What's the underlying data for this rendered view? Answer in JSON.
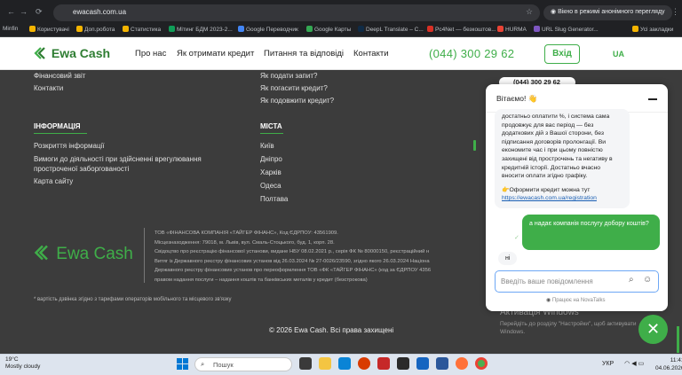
{
  "browser": {
    "url": "ewacash.com.ua",
    "incognito_label": "Вікно в режимі анонімного перегляду",
    "bookmarks": [
      "Minfin",
      "Користувачі",
      "Доп.робота",
      "Статистика",
      "Мітинг БДМ 2023-2...",
      "Google Переводчик",
      "Google Карты",
      "DeepL Translate – C...",
      "Pc4Net — безкоштов...",
      "HURMA",
      "URL Slug Generator...",
      "Усі закладки"
    ]
  },
  "header": {
    "logo": "Ewa Cash",
    "nav": [
      "Про нас",
      "Як отримати кредит",
      "Питання та відповіді",
      "Контакти"
    ],
    "phone": "(044) 300 29 62",
    "login_label": "Вхід",
    "lang": "UA"
  },
  "footer": {
    "col1_links_top": [
      "Фінансовий звіт",
      "Контакти"
    ],
    "col2_links_top": [
      "Як подати запит?",
      "Як погасити кредит?",
      "Як подовжити кредит?"
    ],
    "info_heading": "ІНФОРМАЦІЯ",
    "info_links": [
      "Розкриття інформації",
      "Вимоги до діяльності при здійсненні врегулювання простроченої заборгованості",
      "Карта сайту"
    ],
    "cities_heading": "МІСТА",
    "cities": [
      "Київ",
      "Дніпро",
      "Харків",
      "Одеса",
      "Полтава"
    ],
    "logo": "Ewa Cash",
    "legal": [
      "ТОВ «ФІНАНСОВА КОМПАНІЯ «ТАЙГЕР ФІНАНС», Код ЄДРПОУ: 43561909.",
      "Місцезнаходження: 79018, м. Львів, вул. Смаль-Стоцького, буд. 1, корп. 28.",
      "Свідоцтво про реєстрацію фінансової установи, видане НБУ 08.02.2021 р., серія ФК № 80000150, реєстраційний н",
      "Витяг із Державного реєстру фінансових установ від 26.03.2024 № 27-0026/23590, згідно якого 26.03.2024 Націона",
      "Державного реєстру фінансових установ про переоформлення ТОВ «ФК «ТАЙГЕР ФІНАНС» (код за ЄДРПОУ 4356",
      "правом надання послуги – надання коштів та банківських металів у кредит (безстрокова)"
    ],
    "footnote": "* вартість дзвінка згідно з тарифами операторів мобільного та місцевого зв'язку",
    "copyright": "© 2026 Ewa Cash. Всі права захищені",
    "activation_title": "Активація Windows",
    "activation_text": "Перейдіть до розділу \"Настройки\", щоб активувати Windows."
  },
  "chat": {
    "phone_bubble": "(044) 300 29 62",
    "greeting": "Вітаємо! 👋",
    "bot_message": "достатньо оплатити %, і система сама продовжує для вас період — без додаткових дій з Вашої сторони, без підписання договорів пролонгації. Ви економите час і при цьому повністю захищені від прострочень та негативу в кредитній історії. Достатньо вчасно вносити оплати згідно графіку.",
    "bot_cta": "👉Оформити кредит можна тут",
    "bot_link": "https://ewacash.com.ua/registration",
    "user_message": "а надає компанія послугу добору коштів?",
    "reply_short": "ні",
    "input_placeholder": "Введіть ваше повідомлення",
    "powered_by": "Працює на NovaTalks"
  },
  "taskbar": {
    "weather_temp": "19°C",
    "weather_desc": "Mostly cloudy",
    "search_placeholder": "Пошук",
    "lang": "УКР",
    "time": "11:41",
    "date": "04.06.2026"
  },
  "colors": {
    "accent": "#3fae49",
    "footer_bg": "#3c3c3c",
    "chrome_bg": "#202124"
  },
  "icons": [
    "back-icon",
    "forward-icon",
    "reload-icon",
    "star-icon",
    "incognito-icon",
    "menu-icon",
    "chat-minimize-icon",
    "attach-icon",
    "emoji-icon",
    "close-icon",
    "windows-start-icon"
  ]
}
